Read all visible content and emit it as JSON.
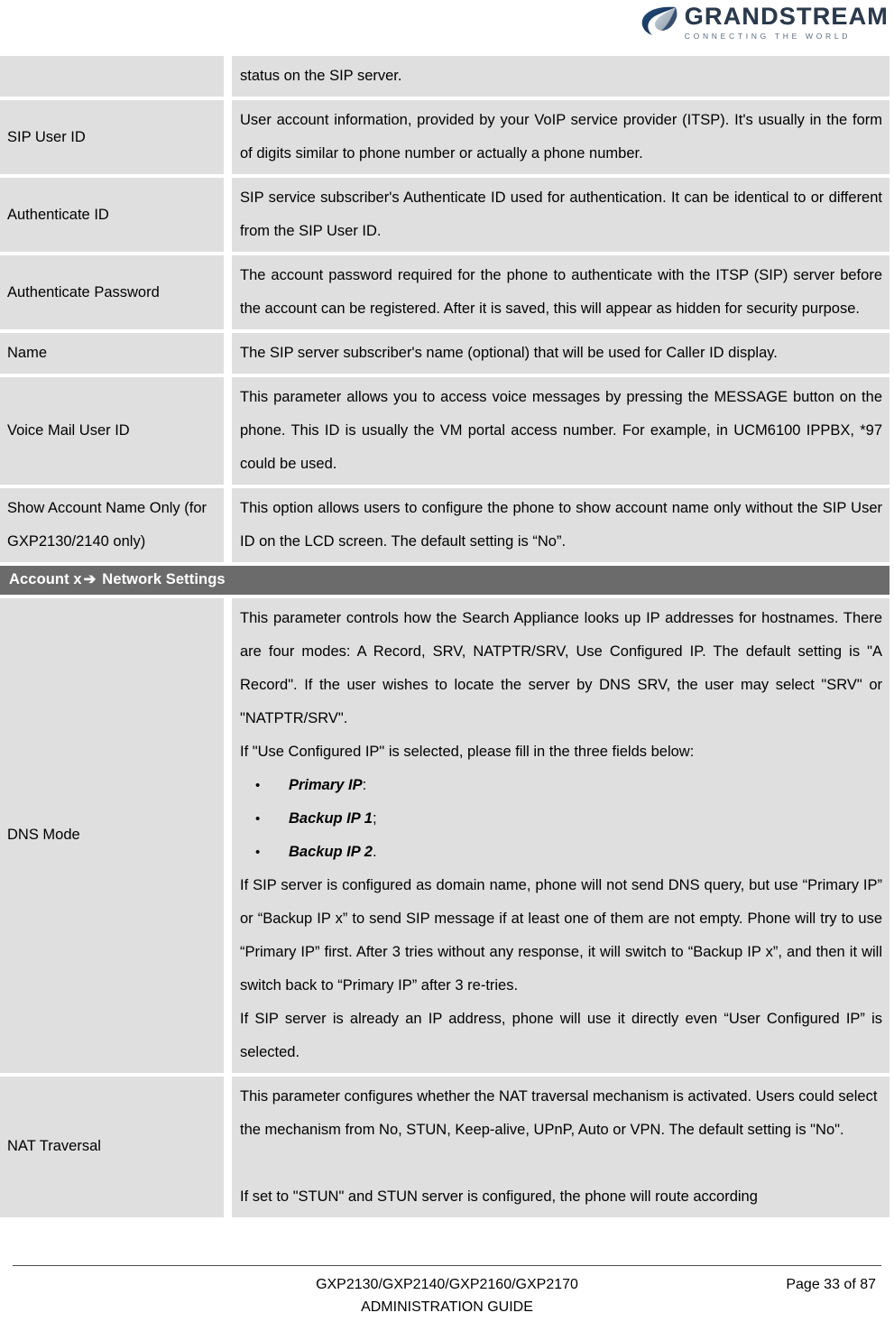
{
  "header": {
    "logo_word": "GRANDSTREAM",
    "logo_tagline": "CONNECTING THE WORLD",
    "logo_icon_name": "grandstream-swoosh-logo"
  },
  "table": {
    "continued_row": {
      "label": "",
      "description": "status on the SIP server."
    },
    "rows": [
      {
        "label": "SIP User ID",
        "description": "User account information, provided by your VoIP service provider (ITSP). It's usually in the form of digits similar to phone number or actually a phone number."
      },
      {
        "label": "Authenticate ID",
        "description": "SIP service subscriber's Authenticate ID used for authentication. It can be identical to or different from the SIP User ID."
      },
      {
        "label": "Authenticate Password",
        "description": "The account password required for the phone to authenticate with the ITSP (SIP) server before the account can be registered. After it is saved, this will appear as hidden for security purpose."
      },
      {
        "label": "Name",
        "description": "The SIP server subscriber's name (optional) that will be used for Caller ID display."
      },
      {
        "label": "Voice Mail User ID",
        "description": "This parameter allows you to access voice messages by pressing the MESSAGE button on the phone. This ID is usually the VM portal access number. For example, in UCM6100 IPPBX, *97 could be used."
      },
      {
        "label": "Show Account Name Only (for GXP2130/2140 only)",
        "description": "This option allows users to configure the phone to show account name only without the SIP User ID on the LCD screen. The default setting is “No”."
      }
    ],
    "section_header": {
      "prefix": "Account x",
      "arrow": "➔",
      "suffix": "Network Settings"
    },
    "dns_mode": {
      "label": "DNS Mode",
      "para1": "This parameter controls how the Search Appliance looks up IP addresses for hostnames. There are four modes: A Record, SRV, NATPTR/SRV, Use Configured IP. The default setting is \"A Record\". If the user wishes to locate the server by DNS SRV, the user may select \"SRV\" or \"NATPTR/SRV\".",
      "para2": "If \"Use Configured IP\" is selected, please fill in the three fields below:",
      "bullets": [
        {
          "bold": "Primary IP",
          "tail": ":"
        },
        {
          "bold": "Backup IP 1",
          "tail": ";"
        },
        {
          "bold": "Backup IP 2",
          "tail": "."
        }
      ],
      "para3": "If SIP server is configured as domain name, phone will not send DNS query, but use “Primary IP” or “Backup IP x” to send SIP message if at least one of them are not empty. Phone will try to use “Primary IP” first. After 3 tries without any response, it will switch to “Backup IP x”, and then it will switch back to “Primary IP” after 3 re-tries.",
      "para4": "If SIP server is already an IP address, phone will use it directly even “User Configured IP” is selected."
    },
    "nat_traversal": {
      "label": "NAT Traversal",
      "para1": "This parameter configures whether the NAT traversal mechanism is activated. Users could select the mechanism from No, STUN, Keep-alive, UPnP, Auto or VPN. The default setting is \"No\".",
      "para2": "If set to \"STUN\" and STUN server is configured, the phone will route according"
    }
  },
  "footer": {
    "models": "GXP2130/GXP2140/GXP2160/GXP2170",
    "guide": "ADMINISTRATION GUIDE",
    "page": "Page 33 of 87"
  },
  "colors": {
    "cell_bg": "#dfdfdf",
    "section_bar_bg": "#6b6b6b",
    "page_bg": "#ffffff",
    "logo_navy": "#2b3a4c"
  }
}
